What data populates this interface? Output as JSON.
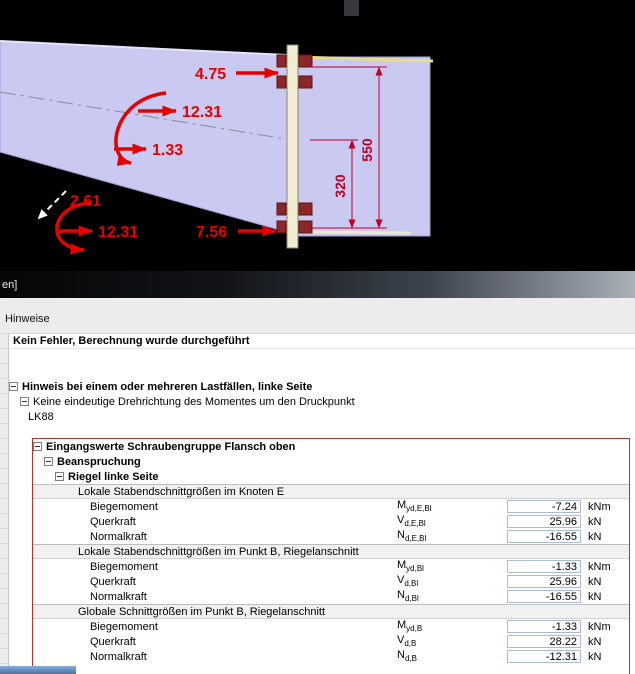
{
  "titlebar": {
    "caption_fragment": "en]"
  },
  "viewport": {
    "force_labels": {
      "f_top": "4.75",
      "f_mid": "12.31",
      "f_low": "1.33",
      "f_b1": "2.61",
      "f_b2": "12.31",
      "f_b3": "7.56"
    },
    "dimensions": {
      "outer": "550",
      "inner": "320"
    },
    "colors": {
      "member_fill": "#c9c9f2",
      "force_red": "#e60000",
      "dimension_red": "#c00024",
      "plate_fill": "#f2edd2"
    }
  },
  "panel": {
    "title": "Hinweise"
  },
  "notes": {
    "status_message": "Kein Fehler, Berechnung wurde durchgeführt",
    "tree": [
      {
        "label": "Hinweis bei einem oder mehreren Lastfällen, linke Seite"
      },
      {
        "label": "Keine eindeutige Drehrichtung des Momentes um den Druckpunkt"
      },
      {
        "label": "LK88"
      },
      {
        "label": "Eingangswerte Schraubengruppe Flansch oben"
      },
      {
        "label": "Beanspruchung"
      },
      {
        "label": "Riegel linke Seite"
      }
    ],
    "sections": [
      {
        "title": "Lokale Stabendschnittgrößen im Knoten E",
        "rows": [
          {
            "label": "Biegemoment",
            "symbol": "M",
            "sub": "yd,E,Bl",
            "value": "-7.24",
            "unit": "kNm"
          },
          {
            "label": "Querkraft",
            "symbol": "V",
            "sub": "d,E,Bl",
            "value": "25.96",
            "unit": "kN"
          },
          {
            "label": "Normalkraft",
            "symbol": "N",
            "sub": "d,E,Bl",
            "value": "-16.55",
            "unit": "kN"
          }
        ]
      },
      {
        "title": "Lokale Stabendschnittgrößen im Punkt B, Riegelanschnitt",
        "rows": [
          {
            "label": "Biegemoment",
            "symbol": "M",
            "sub": "yd,Bl",
            "value": "-1.33",
            "unit": "kNm"
          },
          {
            "label": "Querkraft",
            "symbol": "V",
            "sub": "d,Bl",
            "value": "25.96",
            "unit": "kN"
          },
          {
            "label": "Normalkraft",
            "symbol": "N",
            "sub": "d,Bl",
            "value": "-16.55",
            "unit": "kN"
          }
        ]
      },
      {
        "title": "Globale Schnittgrößen im Punkt B, Riegelanschnitt",
        "rows": [
          {
            "label": "Biegemoment",
            "symbol": "M",
            "sub": "yd,B",
            "value": "-1.33",
            "unit": "kNm"
          },
          {
            "label": "Querkraft",
            "symbol": "V",
            "sub": "d,B",
            "value": "28.22",
            "unit": "kN"
          },
          {
            "label": "Normalkraft",
            "symbol": "N",
            "sub": "d,B",
            "value": "-12.31",
            "unit": "kN"
          }
        ]
      }
    ]
  }
}
